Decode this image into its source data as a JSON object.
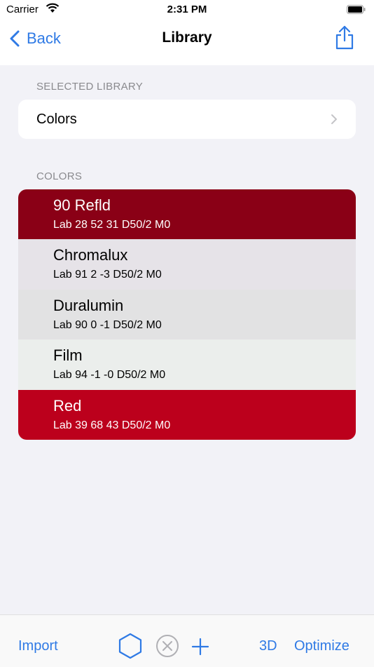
{
  "status_bar": {
    "carrier": "Carrier",
    "time": "2:31 PM"
  },
  "nav": {
    "back_label": "Back",
    "title": "Library"
  },
  "selected_library": {
    "header": "SELECTED LIBRARY",
    "value": "Colors"
  },
  "colors": {
    "header": "COLORS",
    "items": [
      {
        "name": "90 Refld",
        "value": "Lab 28 52 31 D50/2 M0",
        "bg": "#8a0016",
        "text": "#ffffff"
      },
      {
        "name": "Chromalux",
        "value": "Lab 91 2 -3 D50/2 M0",
        "bg": "#e6e3e8",
        "text": "#000000"
      },
      {
        "name": "Duralumin",
        "value": "Lab 90 0 -1 D50/2 M0",
        "bg": "#e2e2e3",
        "text": "#000000"
      },
      {
        "name": "Film",
        "value": "Lab 94 -1 -0 D50/2 M0",
        "bg": "#ebeeec",
        "text": "#000000"
      },
      {
        "name": "Red",
        "value": "Lab 39 68 43 D50/2 M0",
        "bg": "#bc001c",
        "text": "#ffffff"
      }
    ]
  },
  "toolbar": {
    "import_label": "Import",
    "three_d_label": "3D",
    "optimize_label": "Optimize"
  },
  "accent_color": "#2f7ae5"
}
